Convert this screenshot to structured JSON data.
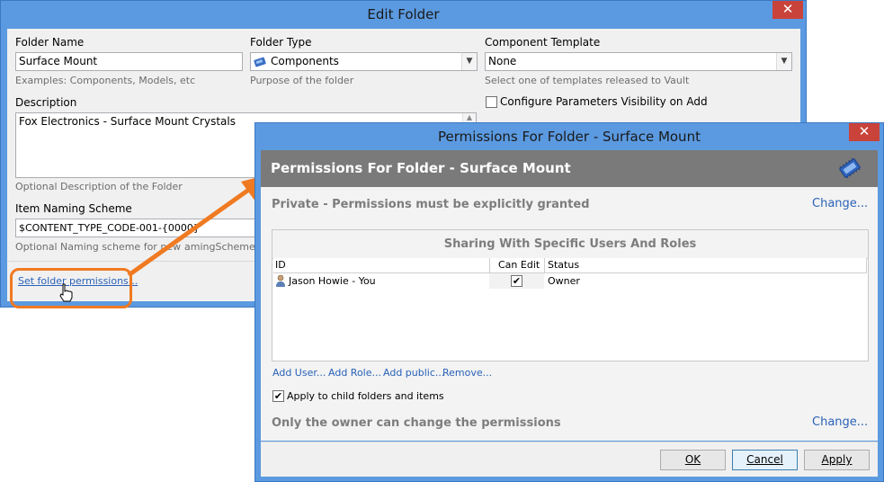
{
  "edit_folder": {
    "title": "Edit Folder",
    "close_glyph": "✕",
    "folder_name_label": "Folder Name",
    "folder_name_value": "Surface Mount",
    "folder_name_hint": "Examples: Components, Models, etc",
    "folder_type_label": "Folder Type",
    "folder_type_value": "Components",
    "folder_type_hint": "Purpose of the folder",
    "component_template_label": "Component Template",
    "component_template_value": "None",
    "component_template_hint": "Select one of templates released to Vault",
    "configure_params_label": "Configure Parameters Visibility on Add",
    "configure_params_checked": false,
    "description_label": "Description",
    "description_value": "Fox Electronics - Surface Mount Crystals",
    "description_hint": "Optional Description of the Folder",
    "naming_label": "Item Naming Scheme",
    "naming_value": "$CONTENT_TYPE_CODE-001-{0000}",
    "naming_hint": "Optional Naming scheme for new ",
    "naming_hint_tail": "amingSchemes",
    "permissions_link": "Set folder permissions..."
  },
  "permissions": {
    "window_title": "Permissions For Folder - Surface Mount",
    "close_glyph": "✕",
    "header_title": "Permissions For Folder - Surface Mount",
    "private_text": "Private - Permissions must be explicitly granted",
    "change_label": "Change...",
    "sharing_title": "Sharing With Specific Users And Roles",
    "columns": [
      "ID",
      "Can Edit",
      "Status"
    ],
    "rows": [
      {
        "id": "Jason Howie - You",
        "can_edit": "✔",
        "status": "Owner"
      }
    ],
    "actions": [
      "Add User...",
      "Add Role...",
      "Add public...",
      "Remove..."
    ],
    "apply_child_label": "Apply to child folders and items",
    "apply_child_checked": "✔",
    "owner_note": "Only the owner can change the permissions",
    "change_label_2": "Change...",
    "ok_label": "OK",
    "cancel_label": "Cancel",
    "apply_label": "Apply"
  },
  "colors": {
    "window_frame": "#5b9ae0",
    "close_button": "#c9433a",
    "highlight": "#f07a21",
    "header_band": "#7a7a7a",
    "link": "#2a62b8"
  }
}
